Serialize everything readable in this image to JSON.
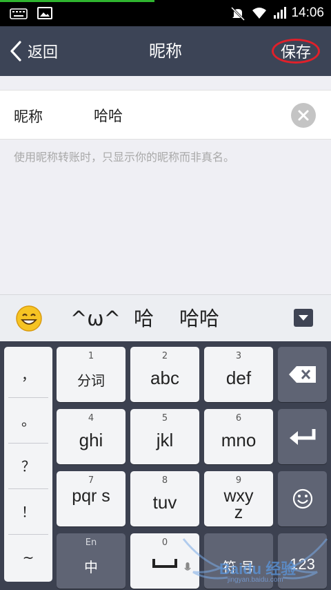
{
  "status_bar": {
    "time": "14:06",
    "icons": [
      "keyboard-icon",
      "image-icon",
      "mute-icon",
      "wifi-icon",
      "signal-icon"
    ]
  },
  "title_bar": {
    "back_label": "返回",
    "title": "昵称",
    "save_label": "保存"
  },
  "form": {
    "label": "昵称",
    "value": "哈哈",
    "hint": "使用昵称转账时，只显示你的昵称而非真名。"
  },
  "candidates": {
    "items": [
      "^ω^",
      "哈",
      "哈哈"
    ]
  },
  "keyboard": {
    "punctuation": [
      "，",
      "。",
      "？",
      "！",
      "~"
    ],
    "keys": [
      {
        "num": "1",
        "label": "分词"
      },
      {
        "num": "2",
        "label": "abc"
      },
      {
        "num": "3",
        "label": "def"
      },
      {
        "num": "4",
        "label": "ghi"
      },
      {
        "num": "5",
        "label": "jkl"
      },
      {
        "num": "6",
        "label": "mno"
      },
      {
        "num": "7",
        "label": "pqr s"
      },
      {
        "num": "8",
        "label": "tuv"
      },
      {
        "num": "9",
        "label": "wxy z"
      }
    ],
    "lang_key": {
      "top": "En",
      "main": "中"
    },
    "space_key": {
      "num": "0"
    },
    "symbol_key": "符 号",
    "num_key": "123"
  },
  "watermark": {
    "text": "Baidu 经验",
    "url": "jingyan.baidu.com"
  },
  "colors": {
    "title_bar_bg": "#3c4456",
    "save_circle": "#e0202a",
    "status_progress": "#2fb52f",
    "keyboard_bg": "#3c4150"
  }
}
